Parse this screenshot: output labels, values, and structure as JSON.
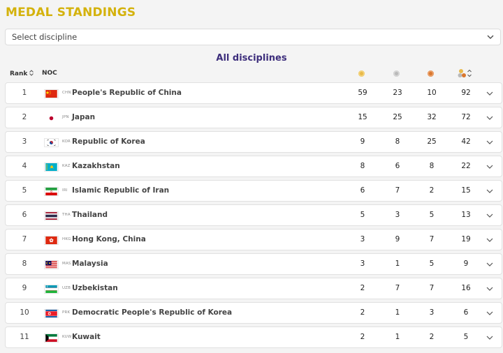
{
  "page_title": "MEDAL STANDINGS",
  "discipline_select": {
    "value": "Select discipline"
  },
  "section_title": "All disciplines",
  "header": {
    "rank": "Rank",
    "noc": "NOC"
  },
  "colors": {
    "title": "#d4b20c",
    "section": "#3d2e7c",
    "gold": "#e8b94a",
    "silver": "#b9b9b9",
    "bronze": "#d9772e"
  },
  "rows": [
    {
      "rank": "1",
      "code": "CHN",
      "name": "People's Republic of China",
      "gold": "59",
      "silver": "23",
      "bronze": "10",
      "total": "92"
    },
    {
      "rank": "2",
      "code": "JPN",
      "name": "Japan",
      "gold": "15",
      "silver": "25",
      "bronze": "32",
      "total": "72"
    },
    {
      "rank": "3",
      "code": "KOR",
      "name": "Republic of Korea",
      "gold": "9",
      "silver": "8",
      "bronze": "25",
      "total": "42"
    },
    {
      "rank": "4",
      "code": "KAZ",
      "name": "Kazakhstan",
      "gold": "8",
      "silver": "6",
      "bronze": "8",
      "total": "22"
    },
    {
      "rank": "5",
      "code": "IRI",
      "name": "Islamic Republic of Iran",
      "gold": "6",
      "silver": "7",
      "bronze": "2",
      "total": "15"
    },
    {
      "rank": "6",
      "code": "THA",
      "name": "Thailand",
      "gold": "5",
      "silver": "3",
      "bronze": "5",
      "total": "13"
    },
    {
      "rank": "7",
      "code": "HKG",
      "name": "Hong Kong, China",
      "gold": "3",
      "silver": "9",
      "bronze": "7",
      "total": "19"
    },
    {
      "rank": "8",
      "code": "MAS",
      "name": "Malaysia",
      "gold": "3",
      "silver": "1",
      "bronze": "5",
      "total": "9"
    },
    {
      "rank": "9",
      "code": "UZB",
      "name": "Uzbekistan",
      "gold": "2",
      "silver": "7",
      "bronze": "7",
      "total": "16"
    },
    {
      "rank": "10",
      "code": "PRK",
      "name": "Democratic People's Republic of Korea",
      "gold": "2",
      "silver": "1",
      "bronze": "3",
      "total": "6"
    },
    {
      "rank": "11",
      "code": "KUW",
      "name": "Kuwait",
      "gold": "2",
      "silver": "1",
      "bronze": "2",
      "total": "5"
    }
  ]
}
